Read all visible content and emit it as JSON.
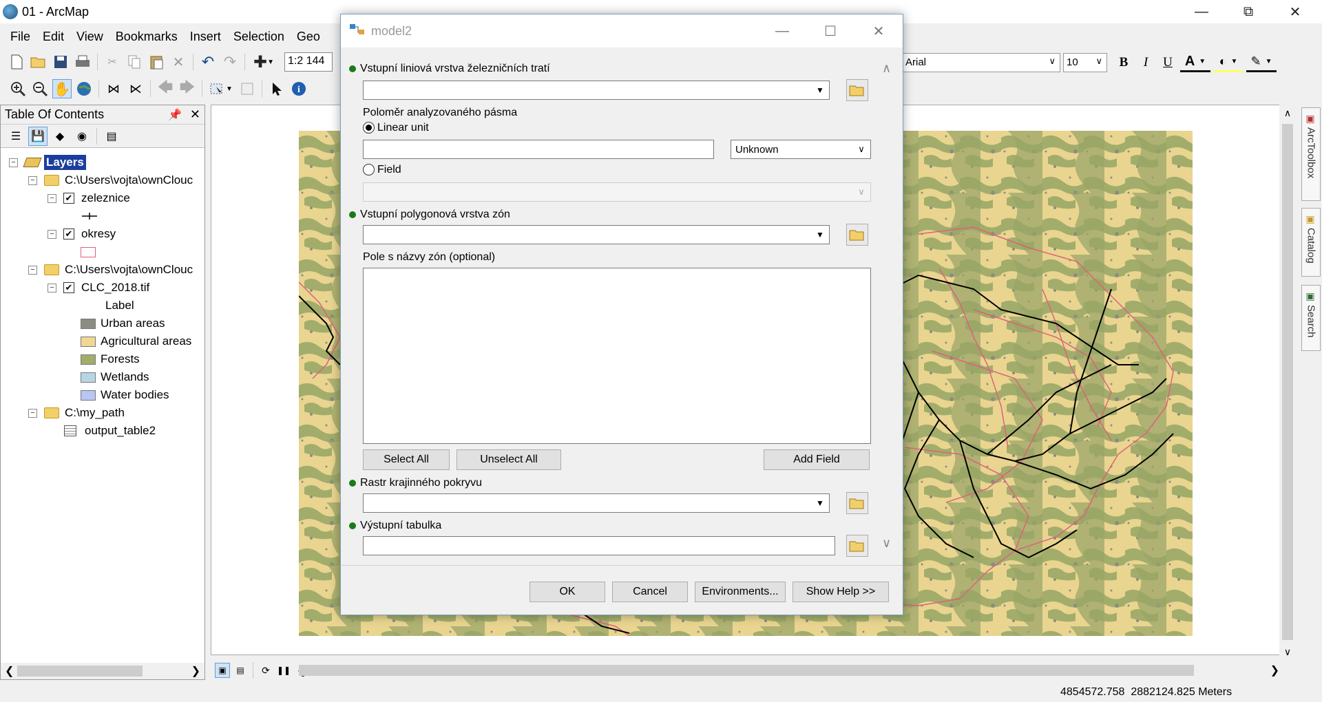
{
  "app": {
    "title": "01 - ArcMap"
  },
  "menu": [
    "File",
    "Edit",
    "View",
    "Bookmarks",
    "Insert",
    "Selection",
    "Geo"
  ],
  "toolbar": {
    "scale": "1:2 144",
    "font": "Arial",
    "font_size": "10"
  },
  "toc": {
    "title": "Table Of Contents",
    "root": "Layers",
    "items": [
      {
        "type": "group",
        "label": "C:\\Users\\vojta\\ownClouc"
      },
      {
        "type": "layer",
        "label": "zeleznice"
      },
      {
        "type": "layer",
        "label": "okresy"
      },
      {
        "type": "group",
        "label": "C:\\Users\\vojta\\ownClouc"
      },
      {
        "type": "layer",
        "label": "CLC_2018.tif"
      },
      {
        "type": "group",
        "label": "C:\\my_path"
      },
      {
        "type": "table",
        "label": "output_table2"
      }
    ],
    "raster_legend_title": "Label",
    "raster_legend": [
      {
        "label": "Urban areas",
        "color": "#8c8c82"
      },
      {
        "label": "Agricultural areas",
        "color": "#f0d795"
      },
      {
        "label": "Forests",
        "color": "#a3ad6b"
      },
      {
        "label": "Wetlands",
        "color": "#b7d6e4"
      },
      {
        "label": "Water bodies",
        "color": "#b8c6f2"
      }
    ]
  },
  "dock": {
    "tabs": [
      "ArcToolbox",
      "Catalog",
      "Search"
    ]
  },
  "dialog": {
    "title": "model2",
    "param_rail": "Vstupní liniová vrstva železničních tratí",
    "param_buffer": "Poloměr analyzovaného pásma",
    "radio_linear": "Linear unit",
    "linear_unit": "Unknown",
    "radio_field": "Field",
    "param_zones": "Vstupní polygonová vrstva zón",
    "param_zone_field": "Pole s názvy zón (optional)",
    "select_all": "Select All",
    "unselect_all": "Unselect All",
    "add_field": "Add Field",
    "param_raster": "Rastr krajinného pokryvu",
    "param_output": "Výstupní tabulka",
    "ok": "OK",
    "cancel": "Cancel",
    "environments": "Environments...",
    "show_help": "Show Help >>"
  },
  "status": {
    "coords": "4854572.758  2882124.825 Meters"
  },
  "colors": {
    "required_dot": "#1a7a1a",
    "rail": "#000000",
    "districts": "#e0607a"
  }
}
